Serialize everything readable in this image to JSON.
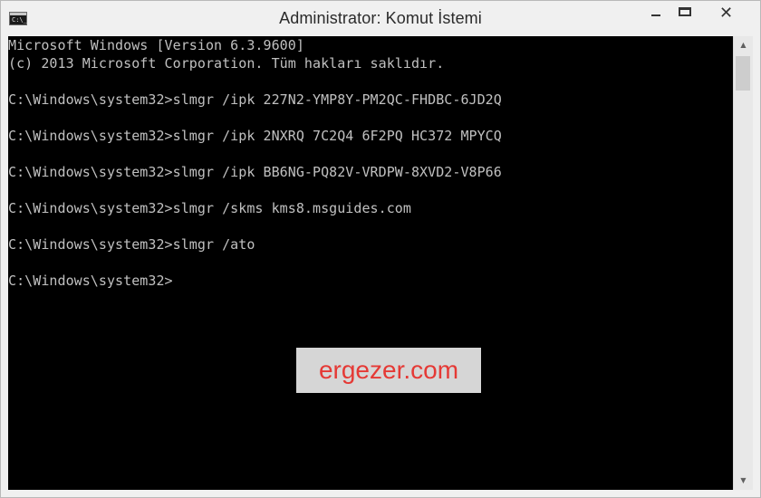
{
  "window": {
    "title": "Administrator: Komut İstemi",
    "icon_text": "C:\\_",
    "buttons": {
      "minimize_icon": "minimize-icon",
      "maximize_icon": "maximize-icon",
      "close_icon": "close-icon",
      "close_glyph": "✕"
    }
  },
  "console": {
    "text_color": "#c0c0c0",
    "background": "#000000",
    "lines": [
      "Microsoft Windows [Version 6.3.9600]",
      "(c) 2013 Microsoft Corporation. Tüm hakları saklıdır.",
      "",
      "C:\\Windows\\system32>slmgr /ipk 227N2-YMP8Y-PM2QC-FHDBC-6JD2Q",
      "",
      "C:\\Windows\\system32>slmgr /ipk 2NXRQ 7C2Q4 6F2PQ HC372 MPYCQ",
      "",
      "C:\\Windows\\system32>slmgr /ipk BB6NG-PQ82V-VRDPW-8XVD2-V8P66",
      "",
      "C:\\Windows\\system32>slmgr /skms kms8.msguides.com",
      "",
      "C:\\Windows\\system32>slmgr /ato",
      "",
      "C:\\Windows\\system32>"
    ]
  },
  "scrollbar": {
    "up_glyph": "▲",
    "down_glyph": "▼"
  },
  "watermark": {
    "text": "ergezer.com",
    "color": "#e53935"
  }
}
